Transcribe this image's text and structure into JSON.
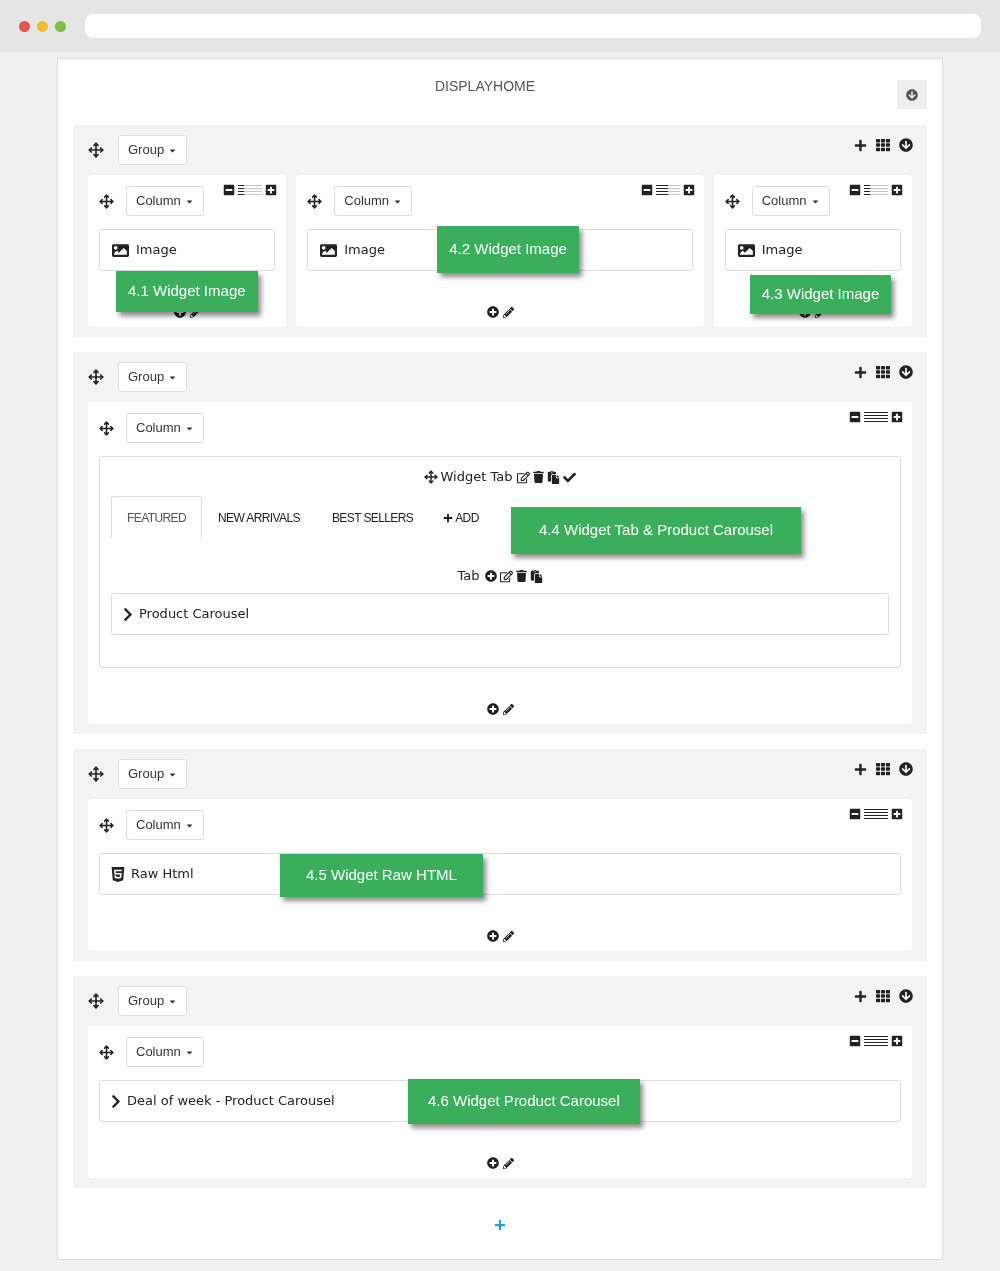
{
  "hook": {
    "title": "DISPLAYHOME"
  },
  "groups": [
    {
      "label": "Group",
      "columns": [
        {
          "label": "Column",
          "level": 0.25,
          "widgets": [
            {
              "kind": "image",
              "label": "Image"
            }
          ],
          "callout": "4.1 Widget Image"
        },
        {
          "label": "Column",
          "level": 0.5,
          "widgets": [
            {
              "kind": "image",
              "label": "Image"
            }
          ],
          "callout": "4.2 Widget Image"
        },
        {
          "label": "Column",
          "level": 0.25,
          "widgets": [
            {
              "kind": "image",
              "label": "Image"
            }
          ],
          "callout": "4.3 Widget Image"
        }
      ]
    },
    {
      "label": "Group",
      "columns": [
        {
          "label": "Column",
          "level": 1,
          "widgets": [
            {
              "kind": "tab",
              "label": "Widget Tab",
              "tabs": [
                {
                  "label": "FEATURED",
                  "selected": true
                },
                {
                  "label": "NEW ARRIVALS",
                  "selected": false
                },
                {
                  "label": "BEST SELLERS",
                  "selected": false
                }
              ],
              "add_label": "ADD",
              "tab_label": "Tab",
              "children": [
                {
                  "kind": "carousel",
                  "label": "Product Carousel"
                }
              ]
            }
          ],
          "callout": "4.4 Widget Tab & Product Carousel"
        }
      ]
    },
    {
      "label": "Group",
      "columns": [
        {
          "label": "Column",
          "level": 1,
          "widgets": [
            {
              "kind": "html",
              "label": "Raw Html"
            }
          ],
          "callout": "4.5 Widget Raw HTML"
        }
      ]
    },
    {
      "label": "Group",
      "columns": [
        {
          "label": "Column",
          "level": 1,
          "widgets": [
            {
              "kind": "carousel",
              "label": "Deal of week - Product Carousel"
            }
          ],
          "callout": "4.6 Widget Product Carousel"
        }
      ]
    }
  ]
}
